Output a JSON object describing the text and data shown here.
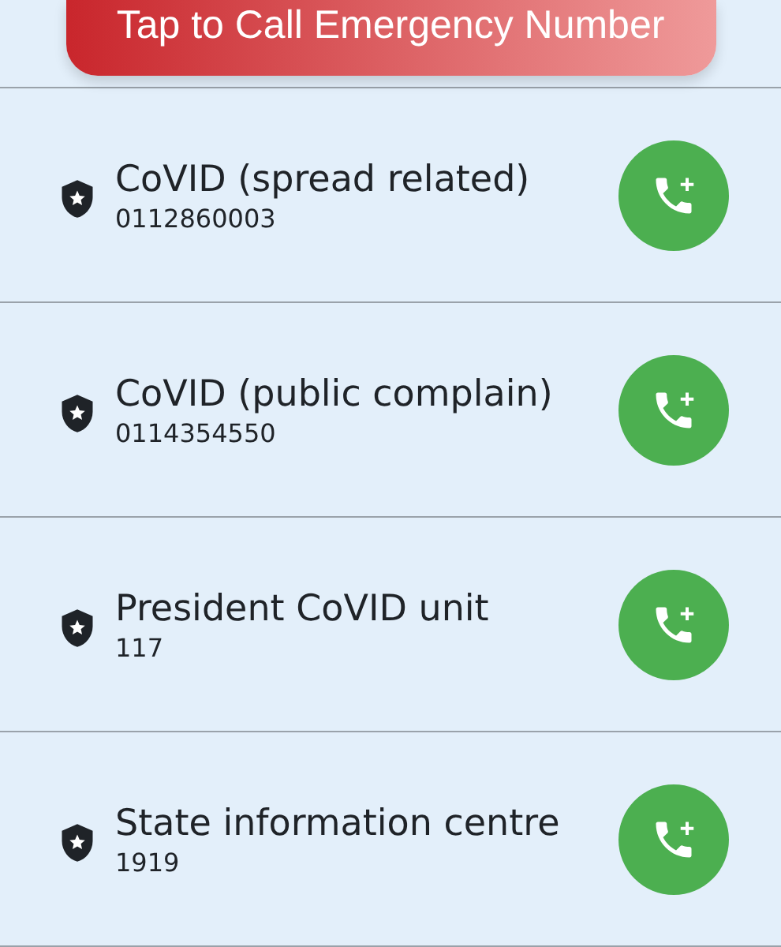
{
  "call_button": {
    "label": "Tap to Call Emergency Number"
  },
  "contacts": [
    {
      "name": "CoVID (spread related)",
      "number": "0112860003"
    },
    {
      "name": "CoVID (public complain)",
      "number": "0114354550"
    },
    {
      "name": "President CoVID unit",
      "number": "117"
    },
    {
      "name": "State information centre",
      "number": "1919"
    }
  ]
}
